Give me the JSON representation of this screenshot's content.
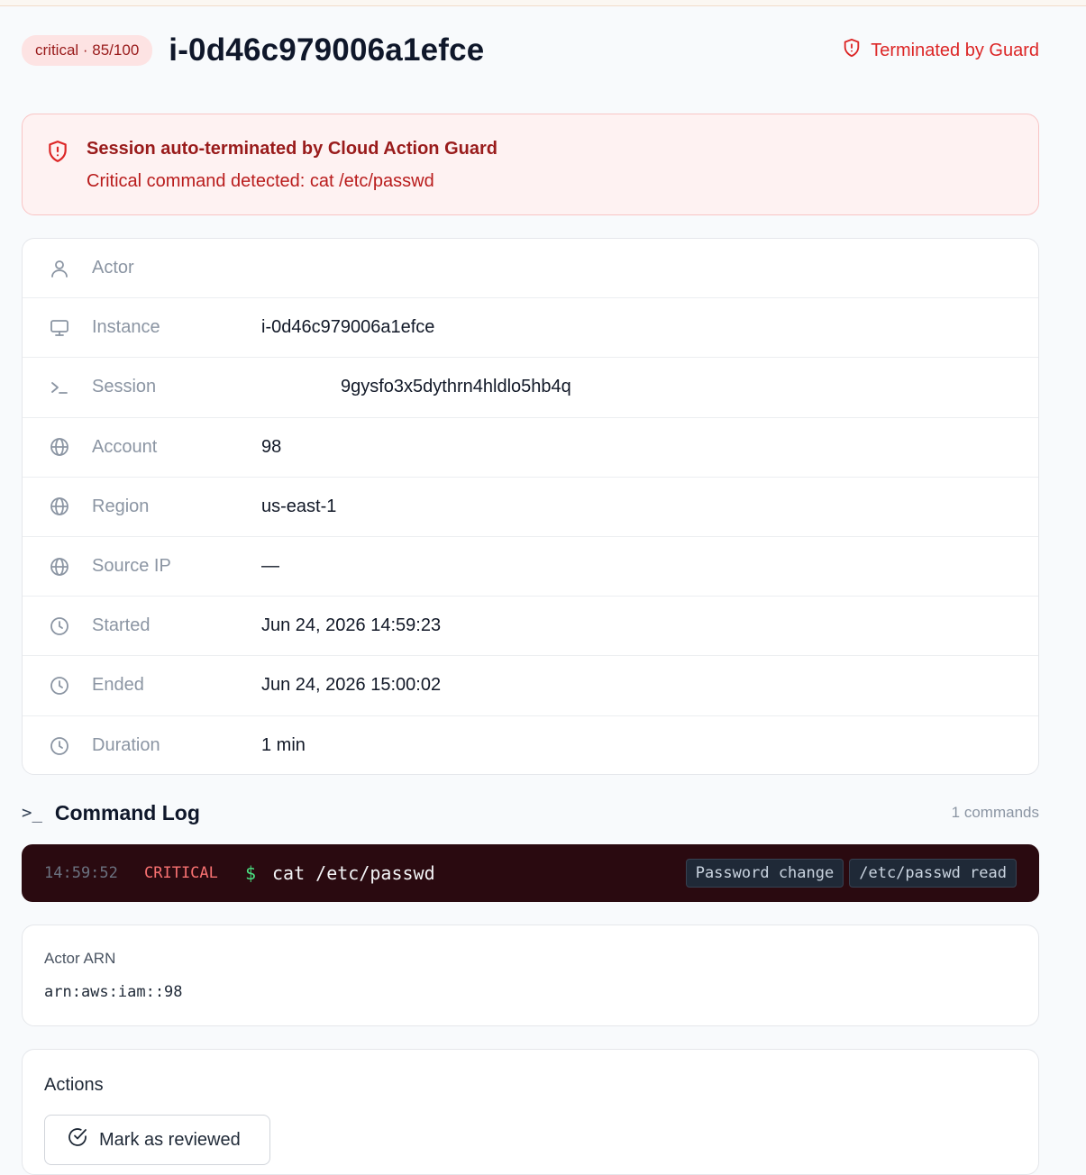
{
  "header": {
    "severity_badge": "critical · 85/100",
    "title": "i-0d46c979006a1efce",
    "status": "Terminated by Guard"
  },
  "alert": {
    "title": "Session auto-terminated by Cloud Action Guard",
    "message": "Critical command detected: cat /etc/passwd"
  },
  "details": [
    {
      "icon": "user-icon",
      "label": "Actor",
      "value": ""
    },
    {
      "icon": "monitor-icon",
      "label": "Instance",
      "value": "i-0d46c979006a1efce"
    },
    {
      "icon": "terminal-icon",
      "label": "Session",
      "value": "9gysfo3x5dythrn4hldlo5hb4q"
    },
    {
      "icon": "globe-icon",
      "label": "Account",
      "value": "98"
    },
    {
      "icon": "globe-icon",
      "label": "Region",
      "value": "us-east-1"
    },
    {
      "icon": "globe-icon",
      "label": "Source IP",
      "value": "—"
    },
    {
      "icon": "clock-icon",
      "label": "Started",
      "value": "Jun 24, 2026 14:59:23"
    },
    {
      "icon": "clock-icon",
      "label": "Ended",
      "value": "Jun 24, 2026 15:00:02"
    },
    {
      "icon": "clock-icon",
      "label": "Duration",
      "value": "1 min"
    }
  ],
  "command_log": {
    "title": "Command Log",
    "count": "1 commands",
    "entries": [
      {
        "time": "14:59:52",
        "severity": "CRITICAL",
        "prompt": "$",
        "command": "cat /etc/passwd",
        "tags": [
          "Password change",
          "/etc/passwd read"
        ]
      }
    ]
  },
  "actor_arn": {
    "label": "Actor ARN",
    "value": "arn:aws:iam::98"
  },
  "actions": {
    "title": "Actions",
    "mark_reviewed": "Mark as reviewed"
  },
  "colors": {
    "danger": "#dc2626",
    "alert_bg": "#fef2f2",
    "log_bg": "#2a0a10",
    "prompt_green": "#4ade80"
  }
}
